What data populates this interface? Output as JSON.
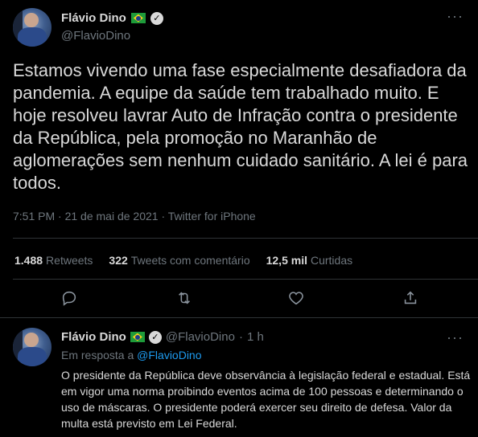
{
  "tweet": {
    "name": "Flávio Dino",
    "flag": "🇧🇷",
    "verified_icon": "verified-check-icon",
    "handle": "@FlavioDino",
    "more_icon": "···",
    "text": "Estamos vivendo uma fase especialmente desafiadora da pandemia. A equipe da saúde tem trabalhado muito. E hoje resolveu lavrar Auto de Infração contra o presidente da República, pela promoção no Maranhão de aglomerações sem nenhum cuidado sanitário. A lei é para todos.",
    "time": "7:51 PM",
    "date": "21 de mai de 2021",
    "source": "Twitter for iPhone",
    "meta_sep": "·",
    "stats": {
      "retweets_count": "1.488",
      "retweets_label": "Retweets",
      "comments_count": "322",
      "comments_label": "Tweets com comentário",
      "likes_count": "12,5 mil",
      "likes_label": "Curtidas"
    }
  },
  "reply": {
    "name": "Flávio Dino",
    "flag": "🇧🇷",
    "handle": "@FlavioDino",
    "sep": "·",
    "age": "1 h",
    "more_icon": "···",
    "in_reply_label": "Em resposta a",
    "in_reply_handle": "@FlavioDino",
    "text": "O presidente da República deve observância à legislação federal e estadual. Está em vigor uma norma proibindo eventos acima de 100 pessoas e determinando o uso de máscaras. O presidente poderá exercer seu direito de defesa. Valor da multa está previsto em Lei Federal."
  },
  "colors": {
    "background": "#000000",
    "text": "#d9d9d9",
    "muted": "#6e767d",
    "link": "#1d9bf0",
    "divider": "#2f3336"
  }
}
